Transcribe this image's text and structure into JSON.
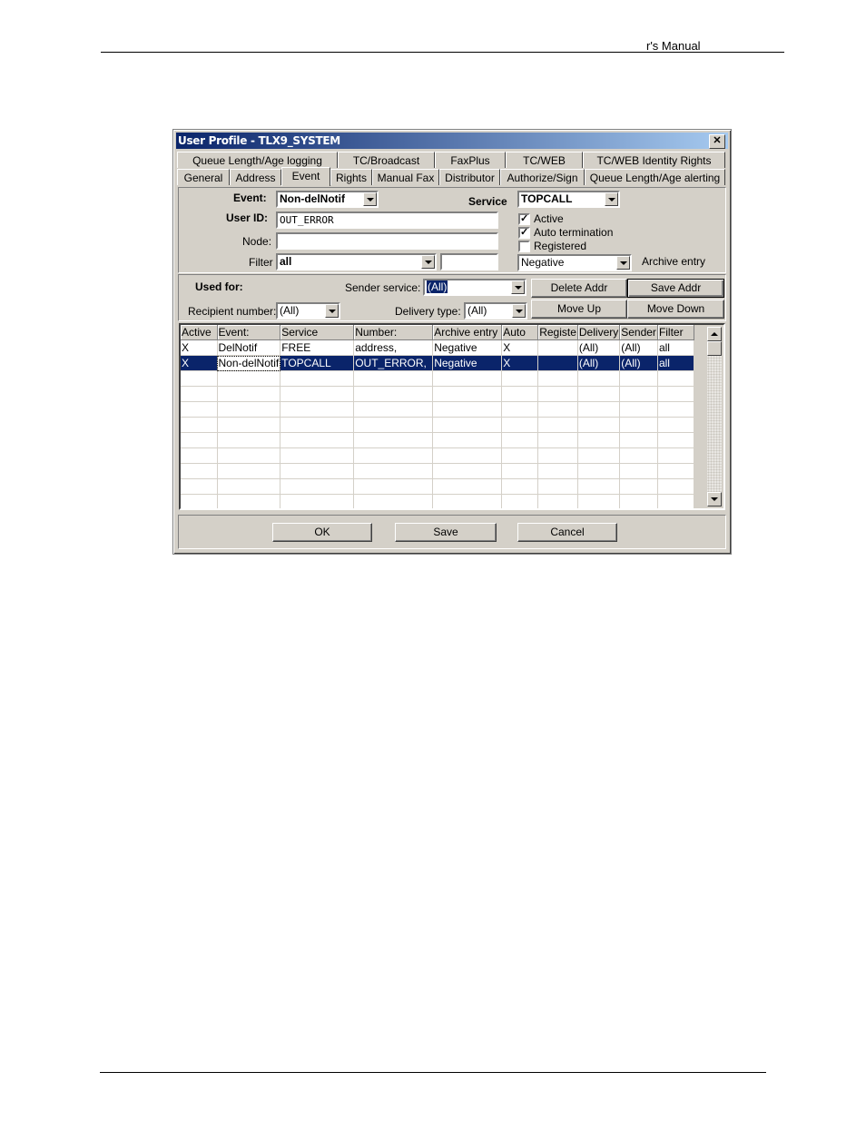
{
  "document": {
    "header_text": "r's Manual"
  },
  "window": {
    "title": "User Profile - TLX9_SYSTEM",
    "close_label": "✕"
  },
  "tabs_row1": [
    {
      "label": "Queue Length/Age logging"
    },
    {
      "label": "TC/Broadcast"
    },
    {
      "label": "FaxPlus"
    },
    {
      "label": "TC/WEB"
    },
    {
      "label": "TC/WEB Identity Rights"
    }
  ],
  "tabs_row2": [
    {
      "label": "General"
    },
    {
      "label": "Address"
    },
    {
      "label": "Event",
      "active": true
    },
    {
      "label": "Rights"
    },
    {
      "label": "Manual Fax"
    },
    {
      "label": "Distributor"
    },
    {
      "label": "Authorize/Sign"
    },
    {
      "label": "Queue Length/Age alerting"
    }
  ],
  "form": {
    "event_label": "Event:",
    "event_value": "Non-delNotif",
    "service_label": "Service",
    "service_value": "TOPCALL",
    "userid_label": "User ID:",
    "userid_value": "OUT_ERROR",
    "node_label": "Node:",
    "node_value": "",
    "filter_label": "Filter",
    "filter_value": "all",
    "filter_extra_value": "",
    "active_label": "Active",
    "active_checked": true,
    "autoterm_label": "Auto termination",
    "autoterm_checked": true,
    "registered_label": "Registered",
    "registered_checked": false,
    "archive_value": "Negative",
    "archive_label": "Archive entry"
  },
  "used_for": {
    "title": "Used for:",
    "sender_service_label": "Sender service:",
    "sender_service_value": "(All)",
    "recipient_number_label": "Recipient number:",
    "recipient_number_value": "(All)",
    "delivery_type_label": "Delivery type:",
    "delivery_type_value": "(All)",
    "delete_addr": "Delete Addr",
    "save_addr": "Save Addr",
    "move_up": "Move Up",
    "move_down": "Move Down"
  },
  "grid": {
    "columns": [
      "Active",
      "Event:",
      "Service",
      "Number:",
      "Archive entry",
      "Auto",
      "Registe",
      "Delivery",
      "Sender",
      "Filter"
    ],
    "rows": [
      [
        "X",
        "DelNotif",
        "FREE",
        "address,",
        "Negative",
        "X",
        "",
        "(All)",
        "(All)",
        "all"
      ],
      [
        "X",
        "Non-delNotif",
        "TOPCALL",
        "OUT_ERROR,",
        "Negative",
        "X",
        "",
        "(All)",
        "(All)",
        "all"
      ]
    ],
    "selected_row": 1,
    "empty_rows": 9
  },
  "footer_buttons": {
    "ok": "OK",
    "save": "Save",
    "cancel": "Cancel"
  }
}
